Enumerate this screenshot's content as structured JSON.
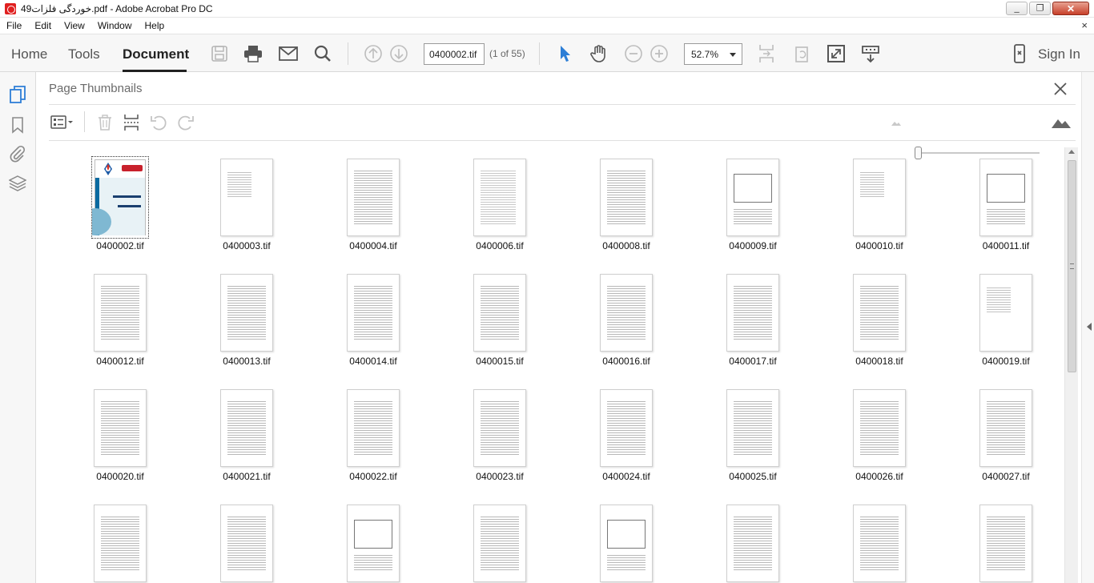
{
  "window": {
    "title": "خوردگی فلزات49.pdf - Adobe Acrobat Pro DC",
    "minimize": "_",
    "restore": "❐",
    "close": "✕"
  },
  "menu": {
    "items": [
      "File",
      "Edit",
      "View",
      "Window",
      "Help"
    ],
    "close_glyph": "×"
  },
  "toolbar": {
    "tabs": [
      "Home",
      "Tools",
      "Document"
    ],
    "active_tab": "Document",
    "page_value": "0400002.tif",
    "page_count": "(1 of 55)",
    "zoom": "52.7%",
    "sign_in": "Sign In",
    "icons": [
      "save-icon",
      "print-icon",
      "email-icon",
      "search-icon",
      "prev-page-icon",
      "next-page-icon",
      "select-cursor-icon",
      "hand-icon",
      "zoom-out-icon",
      "zoom-in-icon",
      "fit-page-icon",
      "rotate-icon",
      "full-screen-icon",
      "read-mode-icon",
      "mobile-link-icon"
    ]
  },
  "rail": {
    "icons": [
      "page-thumbnails-icon",
      "bookmarks-icon",
      "attachments-icon",
      "layers-icon"
    ]
  },
  "panel": {
    "title": "Page Thumbnails",
    "close_glyph": "×",
    "tool_icons": [
      "options-menu-icon",
      "delete-icon",
      "insert-page-icon",
      "rotate-ccw-icon",
      "rotate-cw-icon"
    ]
  },
  "thumbnails": [
    {
      "label": "0400002.tif",
      "kind": "cover",
      "selected": true
    },
    {
      "label": "0400003.tif",
      "kind": "sparse"
    },
    {
      "label": "0400004.tif",
      "kind": "text"
    },
    {
      "label": "0400006.tif",
      "kind": "toc"
    },
    {
      "label": "0400008.tif",
      "kind": "text"
    },
    {
      "label": "0400009.tif",
      "kind": "figure"
    },
    {
      "label": "0400010.tif",
      "kind": "sparse"
    },
    {
      "label": "0400011.tif",
      "kind": "figure"
    },
    {
      "label": "0400012.tif",
      "kind": "text"
    },
    {
      "label": "0400013.tif",
      "kind": "text"
    },
    {
      "label": "0400014.tif",
      "kind": "text"
    },
    {
      "label": "0400015.tif",
      "kind": "text"
    },
    {
      "label": "0400016.tif",
      "kind": "text"
    },
    {
      "label": "0400017.tif",
      "kind": "text"
    },
    {
      "label": "0400018.tif",
      "kind": "text"
    },
    {
      "label": "0400019.tif",
      "kind": "sparse"
    },
    {
      "label": "0400020.tif",
      "kind": "text"
    },
    {
      "label": "0400021.tif",
      "kind": "text"
    },
    {
      "label": "0400022.tif",
      "kind": "text"
    },
    {
      "label": "0400023.tif",
      "kind": "text"
    },
    {
      "label": "0400024.tif",
      "kind": "text"
    },
    {
      "label": "0400025.tif",
      "kind": "text"
    },
    {
      "label": "0400026.tif",
      "kind": "text"
    },
    {
      "label": "0400027.tif",
      "kind": "text"
    },
    {
      "label": "",
      "kind": "text"
    },
    {
      "label": "",
      "kind": "text"
    },
    {
      "label": "",
      "kind": "figure"
    },
    {
      "label": "",
      "kind": "text"
    },
    {
      "label": "",
      "kind": "figure"
    },
    {
      "label": "",
      "kind": "text"
    },
    {
      "label": "",
      "kind": "text"
    },
    {
      "label": "",
      "kind": "text"
    }
  ],
  "cover_text": {
    "line1": "خوردگی خارجی فلزات",
    "line2": "و روش های کنترل آن"
  }
}
